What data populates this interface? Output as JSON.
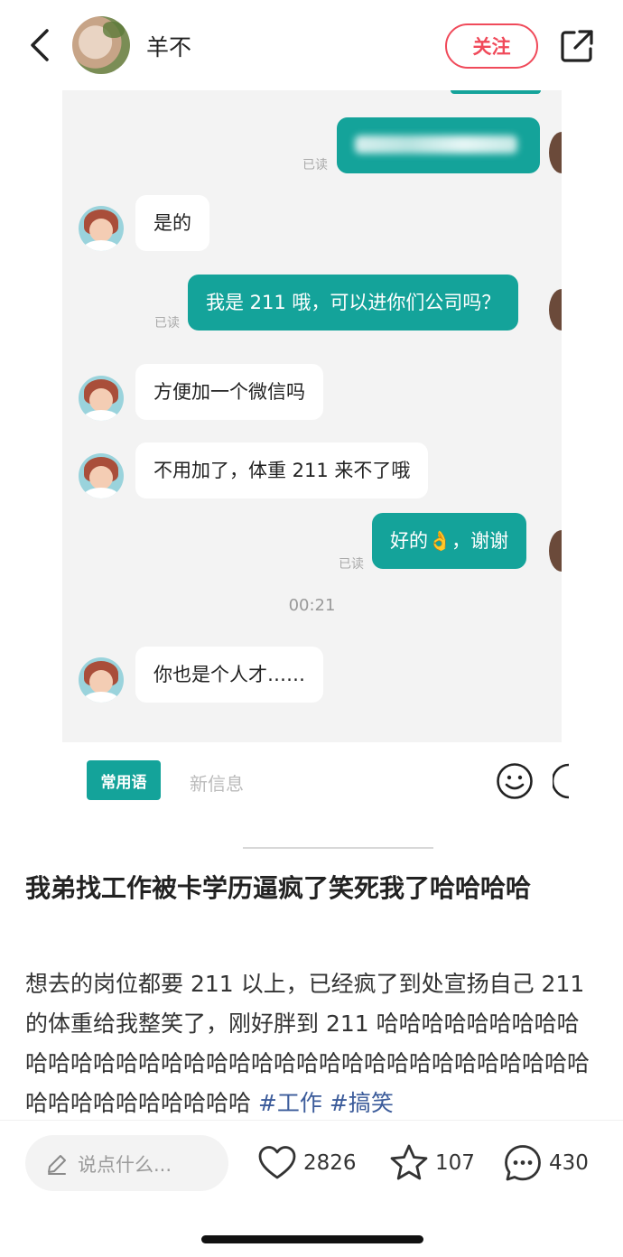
{
  "header": {
    "username": "羊不",
    "follow_label": "关注"
  },
  "chat": {
    "messages": [
      {
        "side": "right",
        "text": "",
        "read": "已读"
      },
      {
        "side": "left",
        "text": "是的"
      },
      {
        "side": "right",
        "text": "我是 211 哦，可以进你们公司吗？",
        "read": "已读"
      },
      {
        "side": "left",
        "text": "方便加一个微信吗"
      },
      {
        "side": "left",
        "text": "不用加了，体重 211 来不了哦"
      },
      {
        "side": "right",
        "text": "好的👌，谢谢",
        "read": "已读"
      },
      {
        "side": "left",
        "text": "你也是个人才……"
      }
    ],
    "timestamp": "00:21",
    "quick_reply_label": "常用语",
    "input_placeholder": "新信息"
  },
  "post": {
    "title": "我弟找工作被卡学历逼疯了笑死我了哈哈哈哈",
    "body": "想去的岗位都要 211 以上，已经疯了到处宣扬自己 211 的体重给我整笑了，刚好胖到 211 哈哈哈哈哈哈哈哈哈哈哈哈哈哈哈哈哈哈哈哈哈哈哈哈哈哈哈哈哈哈哈哈哈哈哈哈哈哈哈哈哈哈哈哈",
    "tags": [
      "#工作",
      "#搞笑"
    ]
  },
  "bottom_bar": {
    "comment_placeholder": "说点什么...",
    "likes": "2826",
    "favorites": "107",
    "comments": "430"
  },
  "colors": {
    "accent_red": "#f04a5a",
    "chat_green": "#14a39a",
    "tag_blue": "#3b5b9a"
  }
}
